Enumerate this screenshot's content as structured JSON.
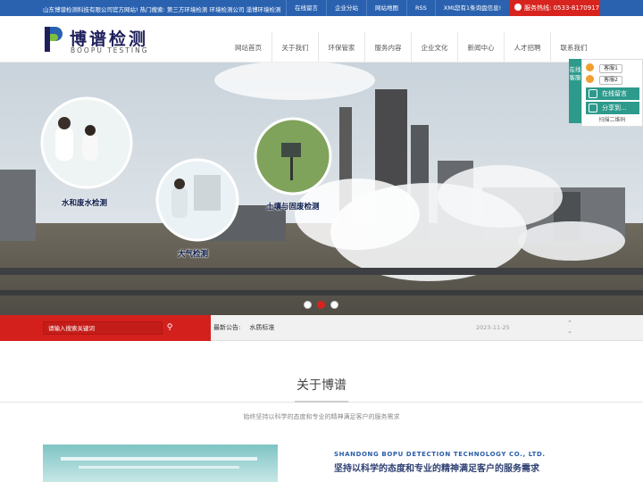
{
  "topbar": {
    "welcome": "山东博谱检测科技有限公司官方网站!  热门搜索: 第三方环境检测  环境检测公司  淄博环境检测",
    "links": [
      "在线留言",
      "企业分站",
      "网站地图",
      "RSS",
      "XML"
    ],
    "inquiry": "您有1条询盘信息!",
    "hotline_label": "服务热线:",
    "hotline_number": "0533-8170917"
  },
  "logo": {
    "cn": "博谱检测",
    "en": "BOOPU TESTING"
  },
  "nav": [
    "网站首页",
    "关于我们",
    "环保管家",
    "服务内容",
    "企业文化",
    "新闻中心",
    "人才招聘",
    "联系我们"
  ],
  "banner": {
    "labels": [
      "水和废水检测",
      "大气检测",
      "土壤与固废检测"
    ],
    "slide_count": 3,
    "active_slide": 2
  },
  "search": {
    "placeholder": "请输入搜索关键词"
  },
  "notice": {
    "label": "最新公告:",
    "value": "水质标准",
    "date": "2023-11-25"
  },
  "about": {
    "title": "关于博谱",
    "subtitle": "始终坚持以科学的态度和专业的精神满足客户的服务需求",
    "company_en": "SHANDONG BOPU DETECTION TECHNOLOGY CO., LTD.",
    "slogan": "坚持以科学的态度和专业的精神满足客户的服务需求"
  },
  "service": {
    "tab": "在线客服",
    "kf1": "客服1",
    "kf2": "客服2",
    "message": "在线留言",
    "share": "分享到...",
    "qr": "扫描二维码"
  },
  "colors": {
    "brand_blue": "#2a62b0",
    "accent_red": "#d8241e",
    "service_green": "#2d9a8c"
  }
}
